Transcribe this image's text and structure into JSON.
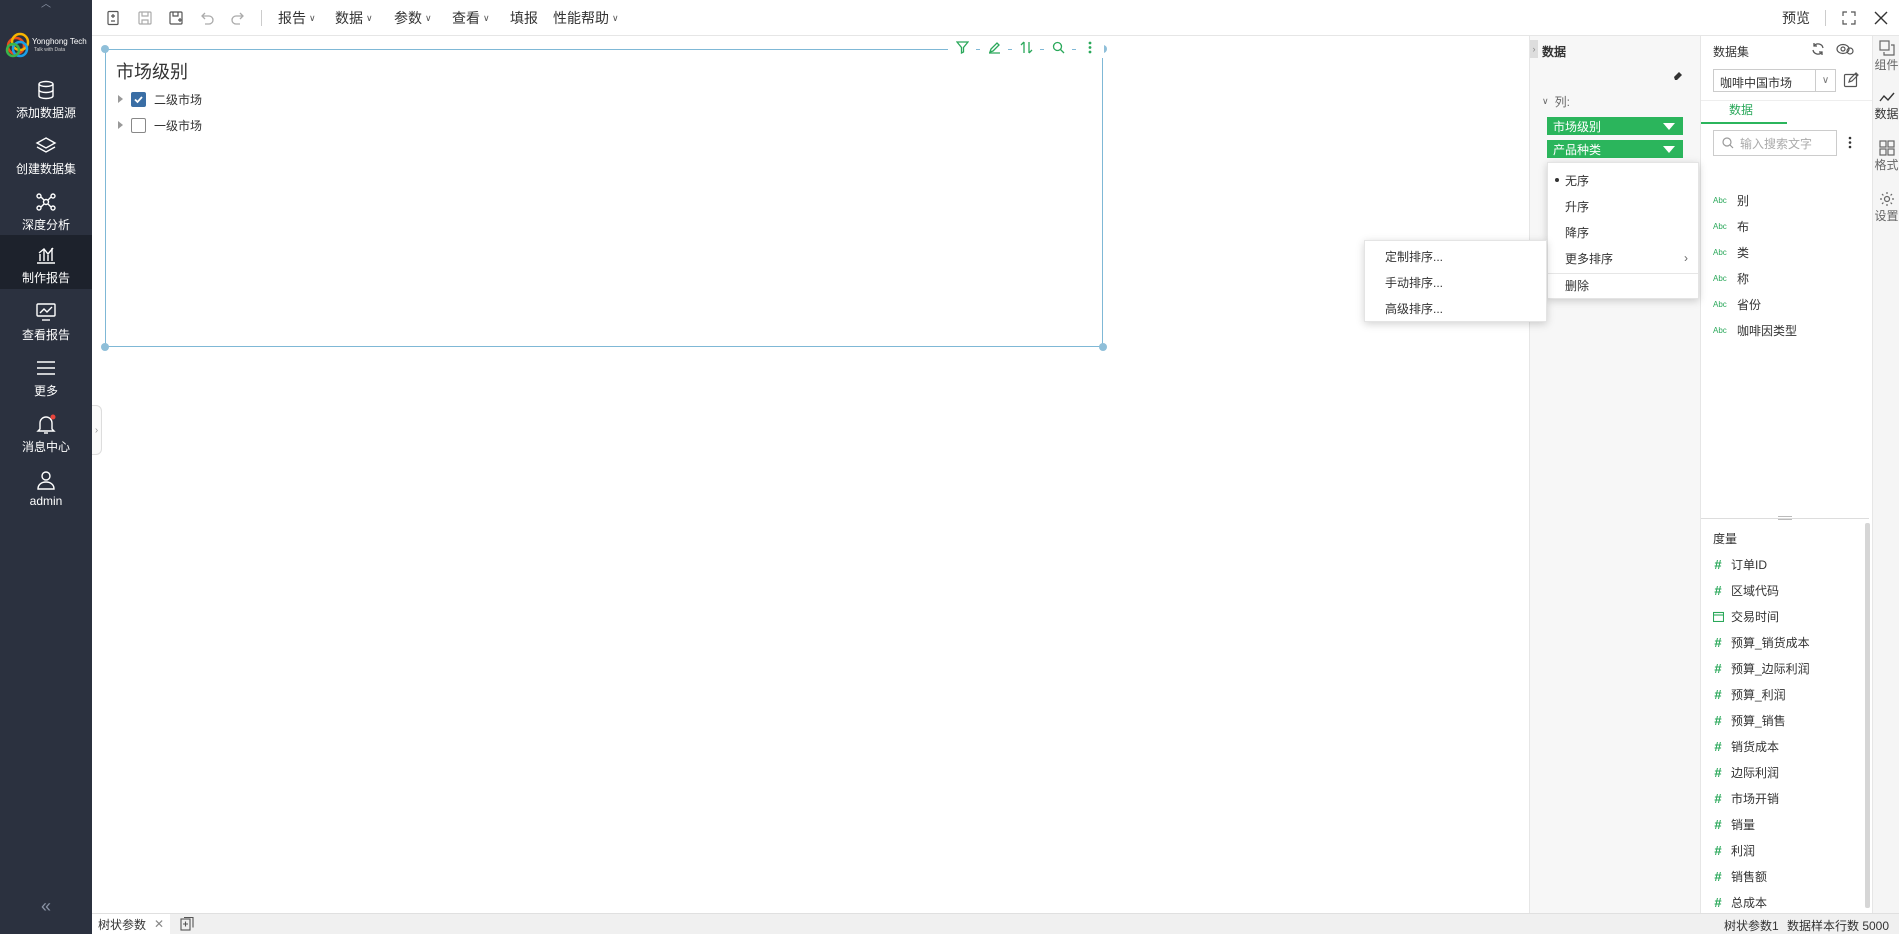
{
  "brand": {
    "name": "Yonghong Tech",
    "slogan": "Talk with Data"
  },
  "nav": {
    "items": [
      {
        "label": "添加数据源",
        "icon": "database-icon"
      },
      {
        "label": "创建数据集",
        "icon": "layers-icon"
      },
      {
        "label": "深度分析",
        "icon": "network-icon"
      },
      {
        "label": "制作报告",
        "icon": "bar-chart-icon"
      },
      {
        "label": "查看报告",
        "icon": "monitor-chart-icon"
      },
      {
        "label": "更多",
        "icon": "menu-icon"
      },
      {
        "label": "消息中心",
        "icon": "bell-icon"
      },
      {
        "label": "admin",
        "icon": "user-icon"
      }
    ],
    "active": "制作报告"
  },
  "toolbar": {
    "menus": [
      "报告",
      "数据",
      "参数",
      "查看",
      "填报",
      "性能帮助"
    ],
    "preview": "预览"
  },
  "widget": {
    "title": "市场级别",
    "items": [
      {
        "label": "二级市场",
        "checked": true
      },
      {
        "label": "一级市场",
        "checked": false
      }
    ]
  },
  "binding_panel": {
    "title": "数据",
    "column_label": "列:",
    "pills": [
      "市场级别",
      "产品种类"
    ]
  },
  "sort_menu": {
    "items": [
      "无序",
      "升序",
      "降序",
      "更多排序",
      "删除"
    ],
    "selected": "无序"
  },
  "more_sort_menu": {
    "items": [
      "定制排序...",
      "手动排序...",
      "高级排序..."
    ]
  },
  "dataset_panel": {
    "title": "数据集",
    "dataset_name": "咖啡中国市场",
    "tab": "数据",
    "search_placeholder": "输入搜索文字",
    "dimensions_partial": [
      {
        "label": "别",
        "type": "text"
      },
      {
        "label": "布",
        "type": "text"
      },
      {
        "label": "类",
        "type": "text"
      },
      {
        "label": "称",
        "type": "text"
      },
      {
        "label": "省份",
        "type": "text"
      },
      {
        "label": "咖啡因类型",
        "type": "text"
      }
    ],
    "measures_title": "度量",
    "measures": [
      {
        "label": "订单ID",
        "type": "number"
      },
      {
        "label": "区域代码",
        "type": "number"
      },
      {
        "label": "交易时间",
        "type": "date"
      },
      {
        "label": "预算_销货成本",
        "type": "number"
      },
      {
        "label": "预算_边际利润",
        "type": "number"
      },
      {
        "label": "预算_利润",
        "type": "number"
      },
      {
        "label": "预算_销售",
        "type": "number"
      },
      {
        "label": "销货成本",
        "type": "number"
      },
      {
        "label": "边际利润",
        "type": "number"
      },
      {
        "label": "市场开销",
        "type": "number"
      },
      {
        "label": "销量",
        "type": "number"
      },
      {
        "label": "利润",
        "type": "number"
      },
      {
        "label": "销售额",
        "type": "number"
      },
      {
        "label": "总成本",
        "type": "number"
      }
    ]
  },
  "rail": {
    "items": [
      "组件",
      "数据",
      "格式",
      "设置"
    ]
  },
  "statusbar": {
    "tab": "树状参数",
    "component": "树状参数1",
    "sample_rows": "数据样本行数 5000"
  },
  "colors": {
    "nav_bg": "#2b313f",
    "accent": "#2bb55c",
    "checkbox": "#3a6ea5"
  }
}
